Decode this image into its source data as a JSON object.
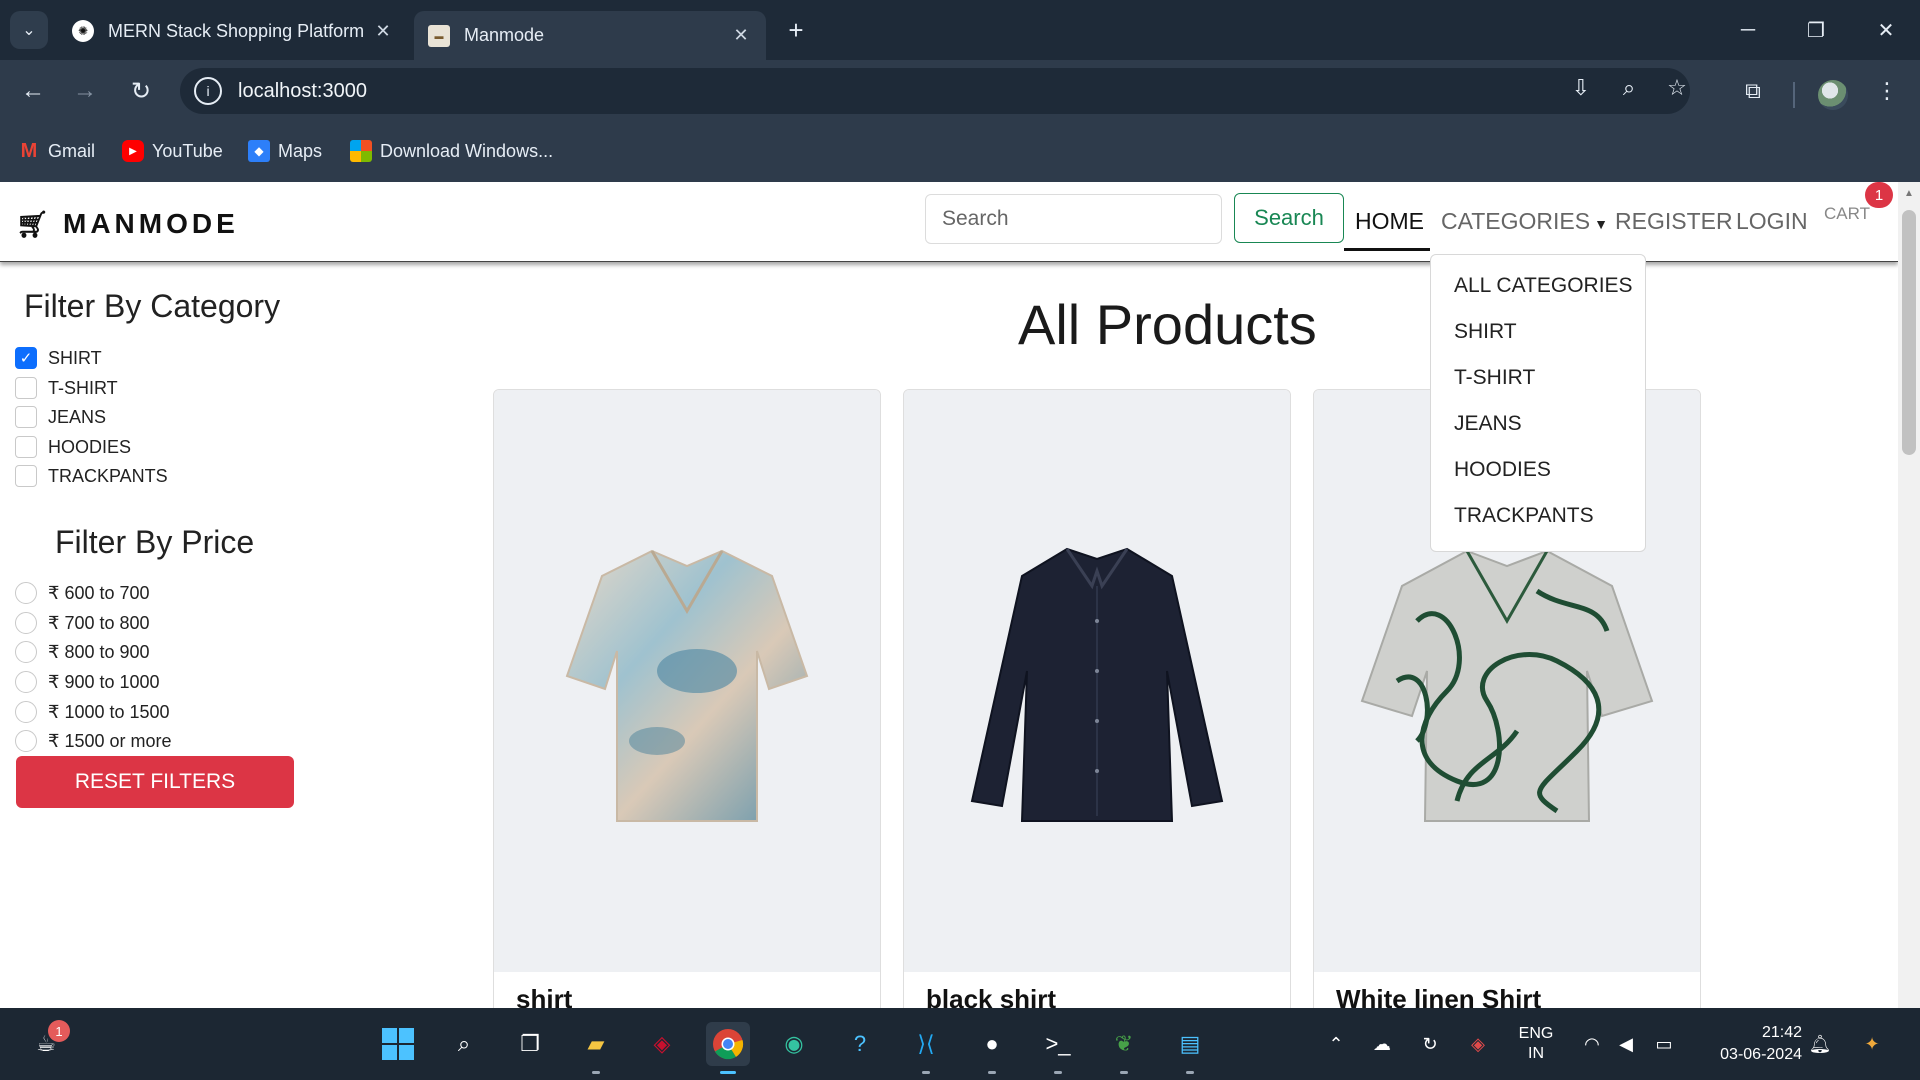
{
  "browser": {
    "tabs": [
      {
        "title": "MERN Stack Shopping Platform",
        "favicon": "openai-icon",
        "active": false
      },
      {
        "title": "Manmode",
        "favicon": "manmode-icon",
        "active": true
      }
    ],
    "url": "localhost:3000",
    "bookmarks": [
      {
        "label": "Gmail",
        "icon": "gmail-icon"
      },
      {
        "label": "YouTube",
        "icon": "youtube-icon"
      },
      {
        "label": "Maps",
        "icon": "maps-icon"
      },
      {
        "label": "Download Windows...",
        "icon": "windows-icon"
      }
    ]
  },
  "navbar": {
    "brand": "MANMODE",
    "search_placeholder": "Search",
    "search_button": "Search",
    "links": {
      "home": "HOME",
      "categories": "CATEGORIES",
      "register": "REGISTER",
      "login": "LOGIN",
      "cart": "CART"
    },
    "cart_count": "1",
    "categories_menu": [
      "ALL CATEGORIES",
      "SHIRT",
      "T-SHIRT",
      "JEANS",
      "HOODIES",
      "TRACKPANTS"
    ]
  },
  "filters": {
    "category_title": "Filter By Category",
    "categories": [
      {
        "label": "SHIRT",
        "checked": true
      },
      {
        "label": "T-SHIRT",
        "checked": false
      },
      {
        "label": "JEANS",
        "checked": false
      },
      {
        "label": "HOODIES",
        "checked": false
      },
      {
        "label": "TRACKPANTS",
        "checked": false
      }
    ],
    "price_title": "Filter By Price",
    "prices": [
      "₹ 600 to 700",
      "₹ 700 to 800",
      "₹ 800 to 900",
      "₹ 900 to 1000",
      "₹ 1000 to 1500",
      "₹ 1500 or more"
    ],
    "reset_label": "RESET FILTERS"
  },
  "products": {
    "title": "All Products",
    "items": [
      {
        "name": "shirt",
        "image": "tie-dye-shirt"
      },
      {
        "name": "black shirt",
        "image": "black-shirt"
      },
      {
        "name": "White linen Shirt",
        "image": "white-pattern-shirt"
      }
    ]
  },
  "taskbar": {
    "notification_count": "1",
    "language": "ENG",
    "region": "IN",
    "time": "21:42",
    "date": "03-06-2024"
  }
}
